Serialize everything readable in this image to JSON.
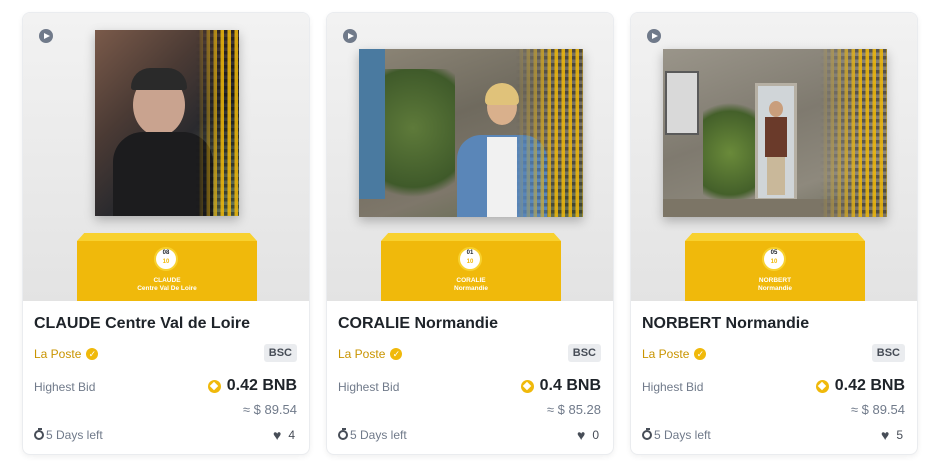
{
  "cards": [
    {
      "title": "CLAUDE Centre Val de Loire",
      "creator": "La Poste",
      "chain": "BSC",
      "bid_label": "Highest Bid",
      "bid_amount": "0.42 BNB",
      "usd_estimate": "≈ $ 89.54",
      "time_left": "5 Days left",
      "likes": "4",
      "badge_top": "08",
      "badge_bottom": "10",
      "pedestal_name": "CLAUDE",
      "pedestal_region": "Centre Val De Loire"
    },
    {
      "title": "CORALIE Normandie",
      "creator": "La Poste",
      "chain": "BSC",
      "bid_label": "Highest Bid",
      "bid_amount": "0.4 BNB",
      "usd_estimate": "≈ $ 85.28",
      "time_left": "5 Days left",
      "likes": "0",
      "badge_top": "01",
      "badge_bottom": "10",
      "pedestal_name": "CORALIE",
      "pedestal_region": "Normandie"
    },
    {
      "title": "NORBERT Normandie",
      "creator": "La Poste",
      "chain": "BSC",
      "bid_label": "Highest Bid",
      "bid_amount": "0.42 BNB",
      "usd_estimate": "≈ $ 89.54",
      "time_left": "5 Days left",
      "likes": "5",
      "badge_top": "05",
      "badge_bottom": "10",
      "pedestal_name": "NORBERT",
      "pedestal_region": "Normandie"
    }
  ],
  "icons": {
    "play": "play-icon",
    "verified": "verified-check-icon",
    "currency": "bnb-coin-icon",
    "timer": "stopwatch-icon",
    "like": "heart-icon"
  },
  "colors": {
    "accent": "#f0b90b",
    "creator_text": "#c99400",
    "text": "#1e2329",
    "muted": "#707a8a"
  }
}
